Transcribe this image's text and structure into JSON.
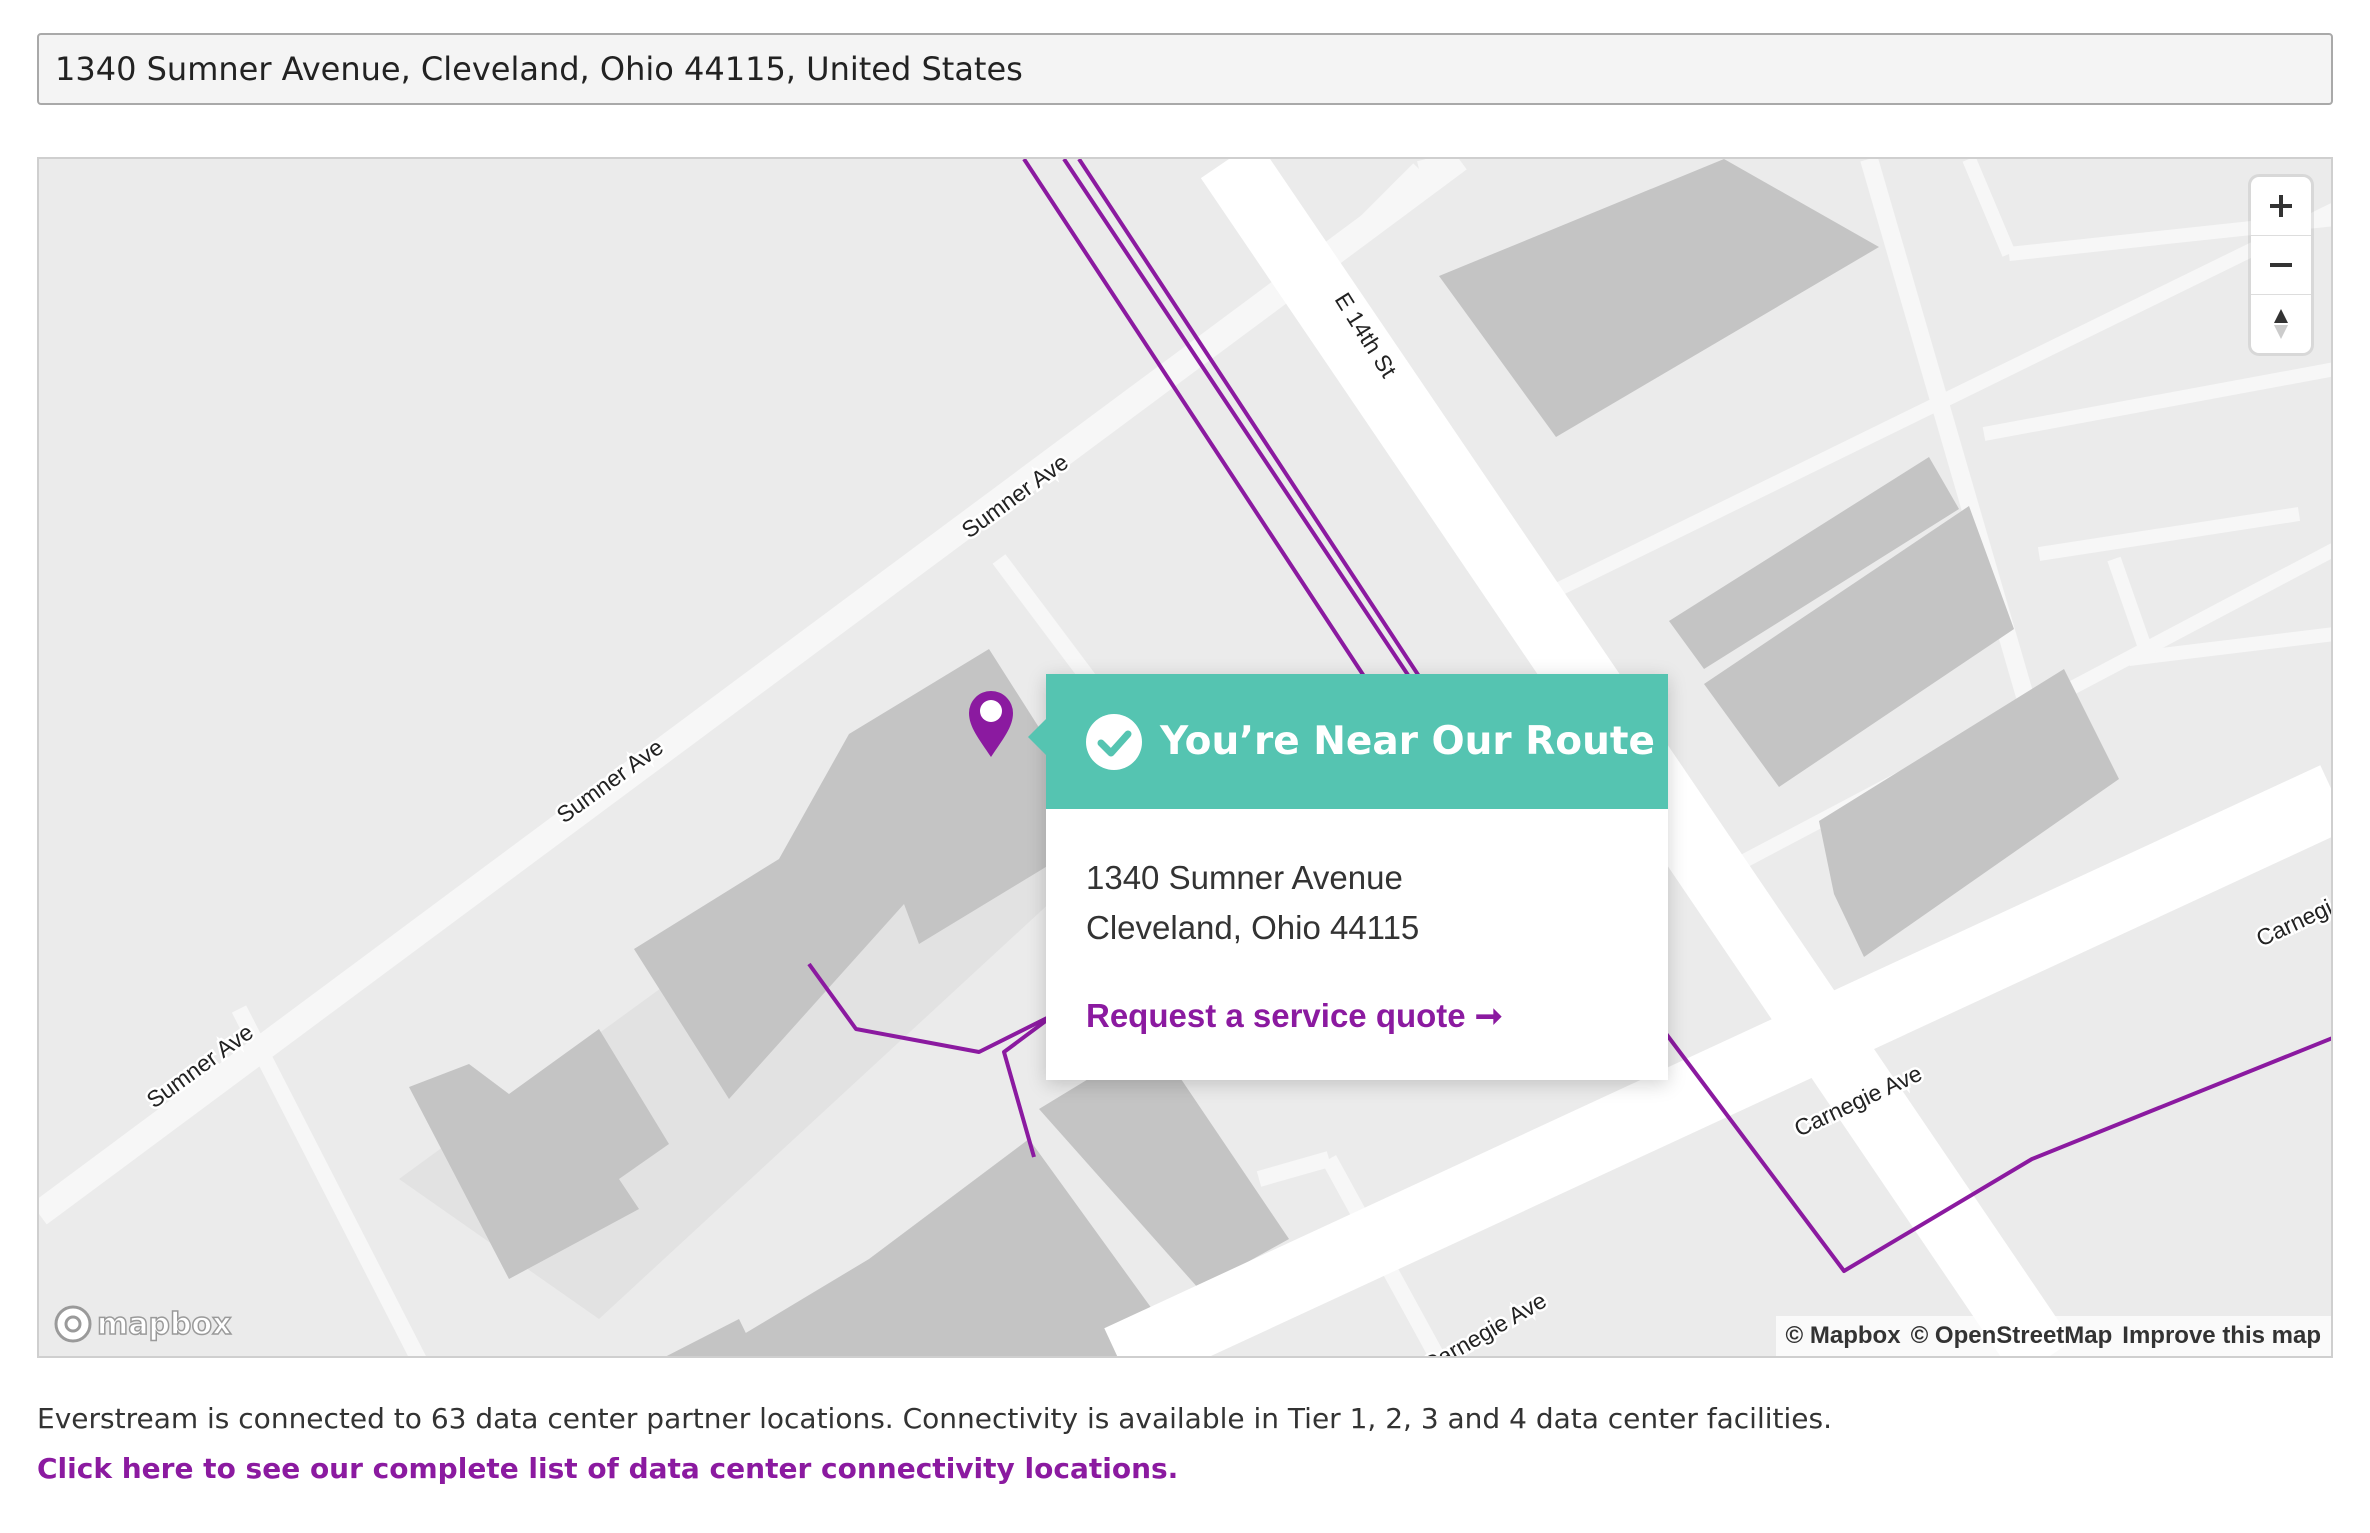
{
  "search": {
    "value": "1340 Sumner Avenue, Cleveland, Ohio 44115, United States"
  },
  "map": {
    "street_labels": {
      "e14th": "E 14th St",
      "sumner_upper": "Sumner Ave",
      "sumner_middle": "Sumner Ave",
      "sumner_lower": "Sumner Ave",
      "carnegie_main": "Carnegie Ave",
      "carnegie_edge": "Carnegi",
      "carnegie_bottom": "Carnegie Ave"
    },
    "controls": {
      "zoom_in_icon": "plus-icon",
      "zoom_out_icon": "minus-icon",
      "compass_icon": "compass-icon"
    },
    "logo_text": "mapbox",
    "attribution": {
      "mapbox": "© Mapbox",
      "osm": "© OpenStreetMap",
      "improve": "Improve this map"
    },
    "colors": {
      "background": "#ebebeb",
      "building": "#c4c4c4",
      "road": "#ffffff",
      "route": "#8b1aa0",
      "marker": "#8b1aa0"
    }
  },
  "popup": {
    "title": "You’re Near Our Route",
    "address_line1": "1340 Sumner Avenue",
    "address_line2": "Cleveland, Ohio 44115",
    "cta": "Request a service quote ➞",
    "header_color": "#55c4b1"
  },
  "footer": {
    "info": "Everstream is connected to 63 data center partner locations. Connectivity is available in Tier 1, 2, 3 and 4 data center facilities.",
    "link": "Click here to see our complete list of data center connectivity locations."
  }
}
